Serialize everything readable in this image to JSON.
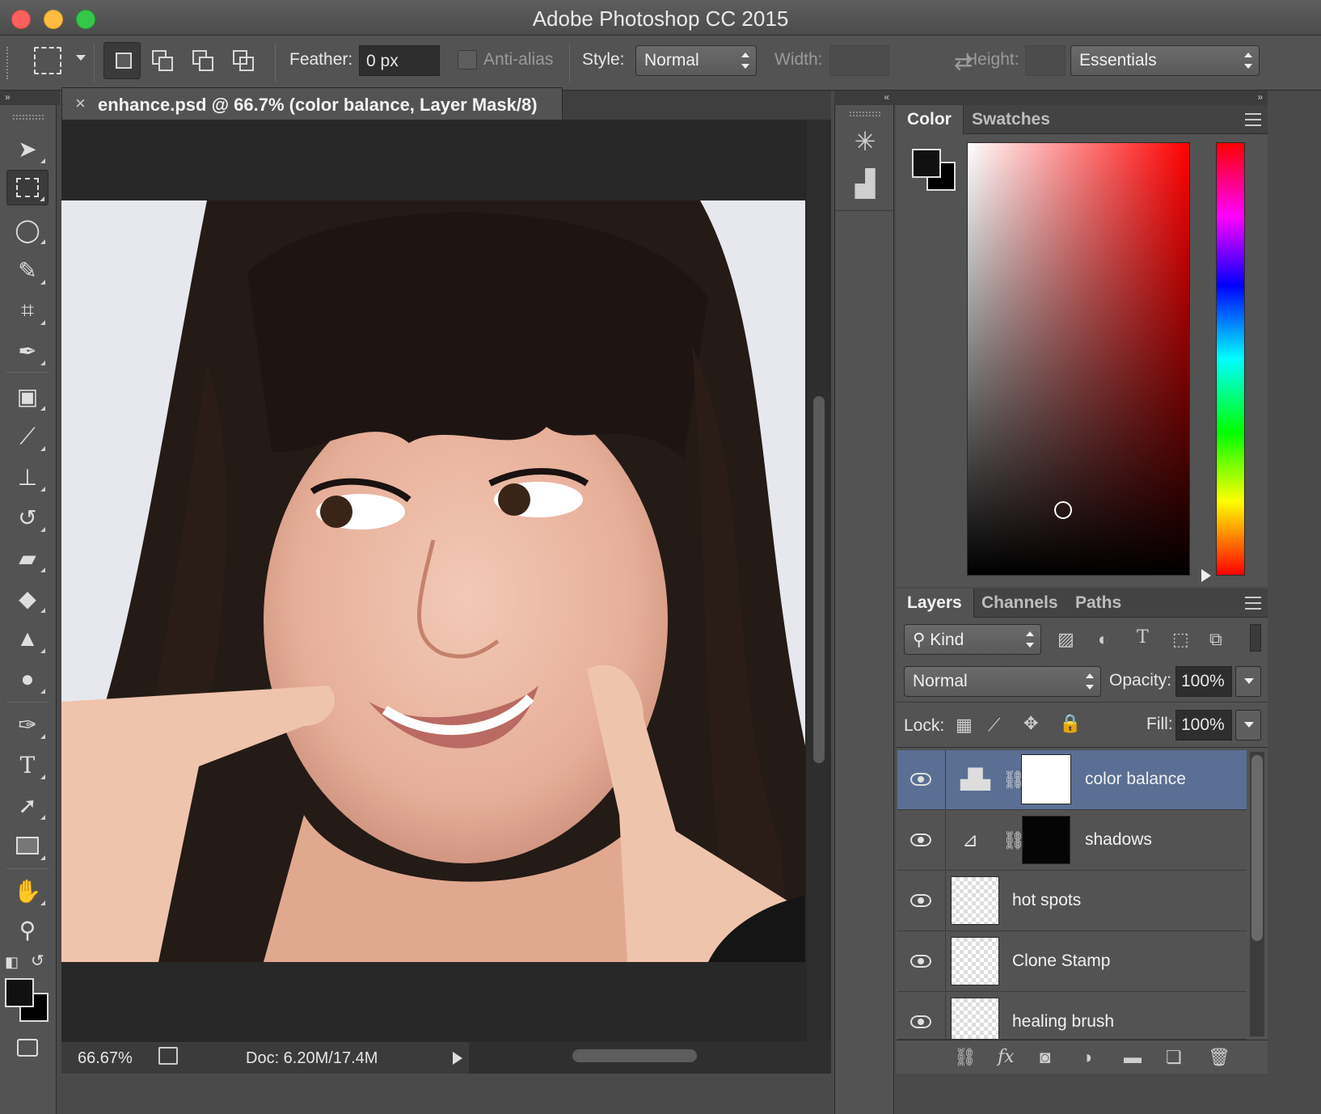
{
  "window": {
    "title": "Adobe Photoshop CC 2015"
  },
  "options": {
    "feather_label": "Feather:",
    "feather_value": "0 px",
    "antialias_label": "Anti-alias",
    "style_label": "Style:",
    "style_value": "Normal",
    "width_label": "Width:",
    "height_label": "Height:",
    "workspace_value": "Essentials"
  },
  "document": {
    "tab_title": "enhance.psd @ 66.7% (color balance, Layer Mask/8)",
    "zoom": "66.67%",
    "doc_size": "Doc: 6.20M/17.4M"
  },
  "color_panel": {
    "tabs": [
      "Color",
      "Swatches"
    ],
    "foreground": "#111111",
    "background": "#000000",
    "picker_hue": "#ff0000"
  },
  "layers_panel": {
    "tabs": [
      "Layers",
      "Channels",
      "Paths"
    ],
    "filter_value": "Kind",
    "blend_mode": "Normal",
    "opacity_label": "Opacity:",
    "opacity_value": "100%",
    "lock_label": "Lock:",
    "fill_label": "Fill:",
    "fill_value": "100%",
    "layers": [
      {
        "name": "color balance",
        "type": "adjustment",
        "selected": true
      },
      {
        "name": "shadows",
        "type": "adjustment"
      },
      {
        "name": "hot spots",
        "type": "pixel"
      },
      {
        "name": "Clone Stamp",
        "type": "pixel"
      },
      {
        "name": "healing brush",
        "type": "pixel"
      }
    ]
  },
  "colors": {
    "selection": "#5a6f93",
    "panel_bg": "#535353"
  }
}
